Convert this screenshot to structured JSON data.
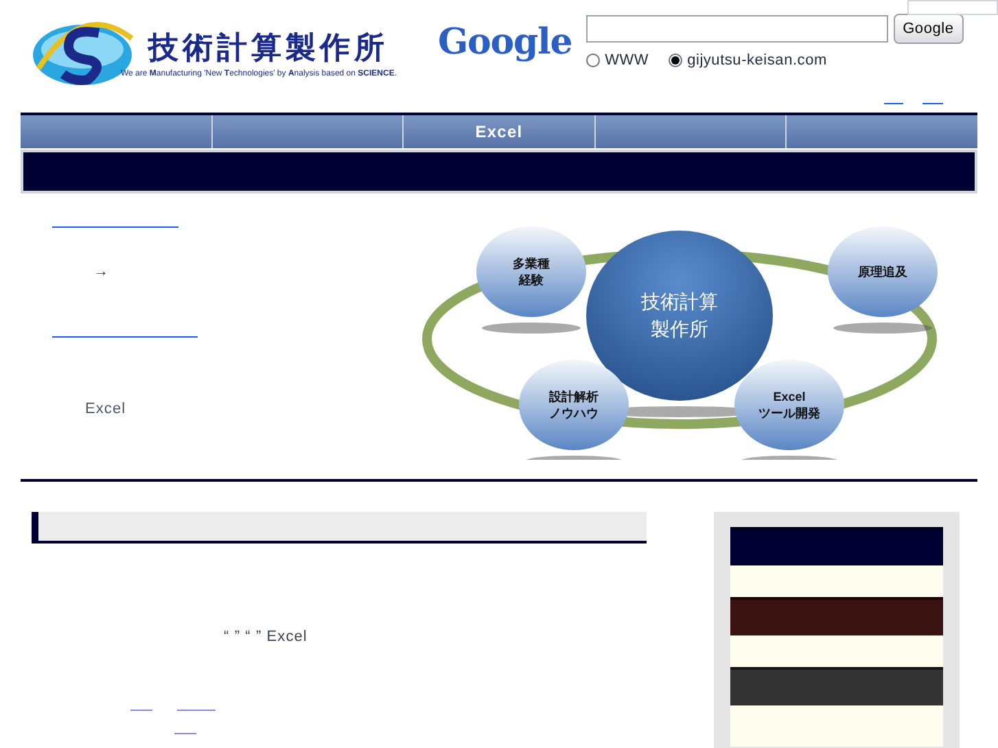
{
  "header": {
    "logo_title": "技術計算製作所",
    "tagline": "We are **M**anufacturing 'New **T**echnologies' by **A**nalysis based on **SCIENCE**."
  },
  "search": {
    "logo": "Google",
    "button": "Google",
    "options": [
      {
        "label": "WWW",
        "selected": false
      },
      {
        "label": "gijyutsu-keisan.com",
        "selected": true
      }
    ]
  },
  "nav": {
    "middle_label": "Excel"
  },
  "intro": {
    "arrow": "→",
    "note": "Excel"
  },
  "diagram": {
    "nodes": [
      {
        "kind": "center",
        "lines": [
          "技術計算",
          "製作所"
        ]
      },
      {
        "kind": "satellite",
        "lines": [
          "多業種",
          "経験"
        ]
      },
      {
        "kind": "satellite",
        "lines": [
          "原理追及"
        ]
      },
      {
        "kind": "satellite",
        "lines": [
          "設計解析",
          "ノウハウ"
        ]
      },
      {
        "kind": "satellite",
        "lines": [
          "Excel",
          "ツール開発"
        ]
      }
    ]
  },
  "main": {
    "quote_text": "“ ” “ ” Excel"
  },
  "sidebar": {
    "blocks": [
      {
        "color": "#000033"
      },
      {
        "color": "#fdfdee"
      },
      {
        "color": "#3a1212"
      },
      {
        "color": "#fdfdee"
      },
      {
        "color": "#333333"
      },
      {
        "color": "#fdfdee"
      }
    ]
  }
}
